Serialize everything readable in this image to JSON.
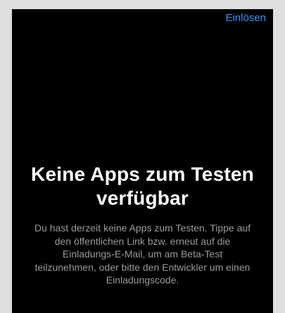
{
  "nav": {
    "redeem_label": "Einlösen"
  },
  "empty_state": {
    "title": "Keine Apps zum Testen verfügbar",
    "message": "Du hast derzeit keine Apps zum Testen. Tippe auf den öffentlichen Link bzw. erneut auf die Einladungs-E-Mail, um am Beta-Test teilzunehmen, oder bitte den Entwickler um einen Einladungscode."
  },
  "colors": {
    "accent": "#3e8ff6",
    "background": "#000000",
    "title": "#ffffff",
    "secondary_text": "#9a9a9e"
  }
}
